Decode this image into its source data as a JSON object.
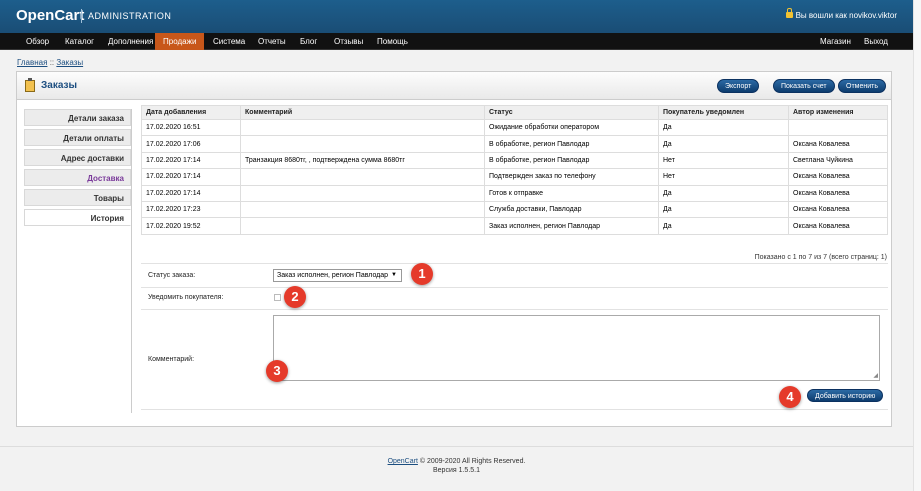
{
  "header": {
    "logo": "OpenCart",
    "logo_admin": "ADMINISTRATION",
    "login_text": "Вы вошли как novikov.viktor"
  },
  "menu": {
    "items": [
      "Обзор",
      "Каталог",
      "Дополнения",
      "Продажи",
      "Система",
      "Отчеты",
      "Блог",
      "Отзывы",
      "Помощь"
    ],
    "active": "Продажи",
    "right": [
      "Магазин",
      "Выход"
    ]
  },
  "breadcrumb": {
    "home": "Главная",
    "sep": "::",
    "current": "Заказы"
  },
  "panel": {
    "title": "Заказы",
    "buttons": {
      "export": "Экспорт",
      "invoice": "Показать счет",
      "cancel": "Отменить"
    }
  },
  "sidebar": {
    "items": [
      "Детали заказа",
      "Детали оплаты",
      "Адрес доставки",
      "Доставка",
      "Товары",
      "История"
    ],
    "selected": "История"
  },
  "history": {
    "headers": [
      "Дата добавления",
      "Комментарий",
      "Статус",
      "Покупатель уведомлен",
      "Автор изменения"
    ],
    "rows": [
      [
        "17.02.2020 16:51",
        "",
        "Ожидание обработки оператором",
        "Да",
        ""
      ],
      [
        "17.02.2020 17:06",
        "",
        "В обработке, регион Павлодар",
        "Да",
        "Оксана Ковалева"
      ],
      [
        "17.02.2020 17:14",
        "Транзакция 8680тг, , подтверждена сумма 8680тг",
        "В обработке, регион Павлодар",
        "Нет",
        "Светлана Чуйкина"
      ],
      [
        "17.02.2020 17:14",
        "",
        "Подтвержден заказ по телефону",
        "Нет",
        "Оксана Ковалева"
      ],
      [
        "17.02.2020 17:14",
        "",
        "Готов к отправке",
        "Да",
        "Оксана Ковалева"
      ],
      [
        "17.02.2020 17:23",
        "",
        "Служба доставки, Павлодар",
        "Да",
        "Оксана Ковалева"
      ],
      [
        "17.02.2020 19:52",
        "",
        "Заказ исполнен, регион Павлодар",
        "Да",
        "Оксана Ковалева"
      ]
    ],
    "pagination": "Показано с 1 по 7 из 7 (всего страниц: 1)"
  },
  "form": {
    "status_label": "Статус заказа:",
    "status_value": "Заказ исполнен, регион Павлодар",
    "notify_label": "Уведомить покупателя:",
    "comment_label": "Комментарий:",
    "add_button": "Добавить историю"
  },
  "markers": [
    "1",
    "2",
    "3",
    "4"
  ],
  "footer": {
    "link": "OpenCart",
    "copyright": " © 2009-2020 All Rights Reserved.",
    "version": "Версия 1.5.5.1"
  },
  "colors": {
    "header": "#1d5e8c",
    "active_menu": "#c8571a",
    "button": "#0d3c6e",
    "marker": "#e53a2a"
  }
}
